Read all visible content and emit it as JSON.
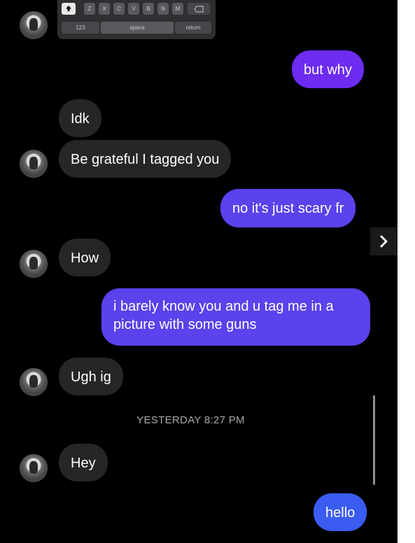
{
  "keyboard": {
    "letter_keys": [
      "Z",
      "X",
      "C",
      "V",
      "B",
      "N",
      "M"
    ],
    "numbers_key": "123",
    "space_key": "space",
    "return_key": "return"
  },
  "messages": [
    {
      "side": "out",
      "text": "but why"
    },
    {
      "side": "in",
      "text": "Idk"
    },
    {
      "side": "in",
      "text": "Be grateful I tagged you"
    },
    {
      "side": "out",
      "text": "no it's just scary fr"
    },
    {
      "side": "in",
      "text": "How"
    },
    {
      "side": "out",
      "text": "i barely know you and u tag me in a picture with some guns"
    },
    {
      "side": "in",
      "text": "Ugh ig"
    },
    {
      "side": "in",
      "text": "Hey"
    },
    {
      "side": "out",
      "text": "hello"
    }
  ],
  "timestamp": "YESTERDAY 8:27 PM",
  "colors": {
    "background": "#000000",
    "incoming_bubble": "#262626",
    "outgoing_purple": "#6d2cf0",
    "outgoing_violet": "#5a42ec",
    "outgoing_blue": "#3a5cf0"
  },
  "icons": {
    "next": "chevron-right-icon",
    "avatar": "profile-avatar"
  }
}
